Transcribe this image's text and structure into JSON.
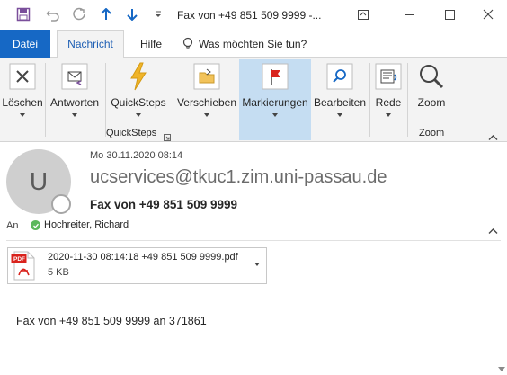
{
  "window": {
    "title": "Fax von +49 851 509 9999  -..."
  },
  "tabs": {
    "file": "Datei",
    "message": "Nachricht",
    "help": "Hilfe",
    "tell_me": "Was möchten Sie tun?"
  },
  "ribbon": {
    "delete": "Löschen",
    "reply": "Antworten",
    "quicksteps": "QuickSteps",
    "quicksteps_group": "QuickSteps",
    "move": "Verschieben",
    "tags": "Markierungen",
    "edit": "Bearbeiten",
    "speech": "Rede",
    "zoom": "Zoom",
    "zoom_group": "Zoom"
  },
  "message": {
    "avatar_initial": "U",
    "date": "Mo 30.11.2020 08:14",
    "sender": "ucservices@tkuc1.zim.uni-passau.de",
    "subject": "Fax von +49 851 509 9999",
    "to_label": "An",
    "to_name": "Hochreiter, Richard",
    "attachment": {
      "filename": "2020-11-30 08:14:18 +49 851 509 9999.pdf",
      "size": "5 KB",
      "badge": "PDF"
    },
    "body": "Fax von +49 851 509 9999 an 371861"
  },
  "colors": {
    "accent": "#1668c5",
    "ribbon_active": "#c5ddf2",
    "pdf_red": "#d9231d",
    "presence_ok": "#5cb85c"
  }
}
